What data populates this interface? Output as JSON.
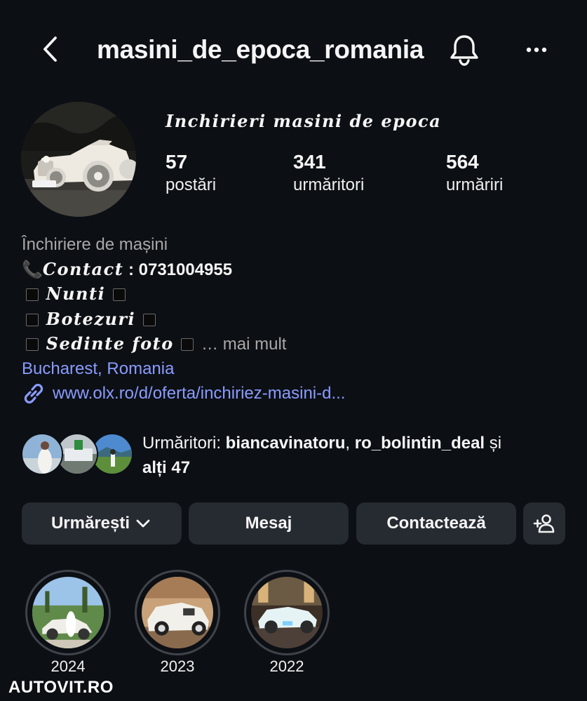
{
  "header": {
    "back_icon": "chevron-left-icon",
    "title": "masini_de_epoca_romania",
    "bell_icon": "bell-icon",
    "more_icon": "more-horizontal-icon"
  },
  "profile": {
    "display_name": "Inchirieri masini de epoca",
    "stats": [
      {
        "value": "57",
        "label": "postări"
      },
      {
        "value": "341",
        "label": "urmăritori"
      },
      {
        "value": "564",
        "label": "urmăriri"
      }
    ]
  },
  "bio": {
    "category": "Închiriere de mașini",
    "phone_emoji": "📞",
    "contact_label": "Contact",
    "contact_value": " : 0731004955",
    "line_nunti": "Nunti",
    "line_botezuri": "Botezuri",
    "line_sedinte": "Sedinte foto",
    "ellipsis": " … ",
    "more_label": "mai mult",
    "location": "Bucharest, Romania",
    "link_icon": "link-icon",
    "link": "www.olx.ro/d/oferta/inchiriez-masini-d..."
  },
  "followers": {
    "prefix": "Urmăritori: ",
    "user1": "biancavinatoru",
    "separator": ", ",
    "user2": "ro_bolintin_deal",
    "and_word": " și",
    "others": "alți 47"
  },
  "actions": {
    "follow": "Urmărești",
    "message": "Mesaj",
    "contact": "Contactează",
    "add_user_icon": "add-user-icon"
  },
  "highlights": [
    {
      "label": "2024"
    },
    {
      "label": "2023"
    },
    {
      "label": "2022"
    }
  ],
  "watermark": "AUTOVIT.RO",
  "colors": {
    "background": "#0c0f14",
    "button": "#262a31",
    "link": "#8a9cff",
    "secondary_text": "#a8a8a8"
  }
}
